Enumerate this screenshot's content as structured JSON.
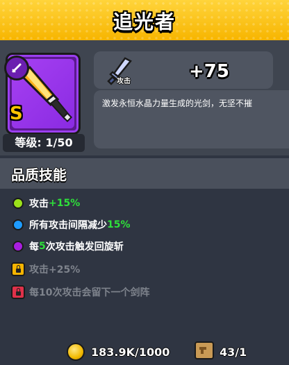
{
  "header": {
    "title": "追光者"
  },
  "item": {
    "rarity_letter": "S",
    "level_text": "等级: 1/50",
    "frame_color": "#9b3ff0",
    "icon": "sword-icon"
  },
  "stat": {
    "label": "攻击",
    "value": "+75",
    "icon": "sword-attack-icon"
  },
  "description": "激发永恒水晶力量生成的光剑，无坚不摧",
  "skills": {
    "title": "品质技能",
    "items": [
      {
        "prefix": "攻击",
        "highlight": "+15%",
        "suffix": "",
        "marker": "dot",
        "color": "#9be21a",
        "locked": false
      },
      {
        "prefix": "所有攻击间隔减少",
        "highlight": "15%",
        "suffix": "",
        "marker": "dot",
        "color": "#1e9bff",
        "locked": false
      },
      {
        "prefix": "每",
        "highlight": "5",
        "suffix": "次攻击触发回旋斩",
        "marker": "dot",
        "color": "#a81ee0",
        "locked": false
      },
      {
        "prefix": "攻击+25%",
        "highlight": "",
        "suffix": "",
        "marker": "lock",
        "color": "#f5b400",
        "locked": true
      },
      {
        "prefix": "每10次攻击会留下一个剑阵",
        "highlight": "",
        "suffix": "",
        "marker": "lock",
        "color": "#e0314a",
        "locked": true
      }
    ]
  },
  "resources": {
    "coins": "183.9K/1000",
    "coin_icon": "gold-coin-icon",
    "scrolls": "43/1",
    "scroll_icon": "scroll-icon"
  }
}
